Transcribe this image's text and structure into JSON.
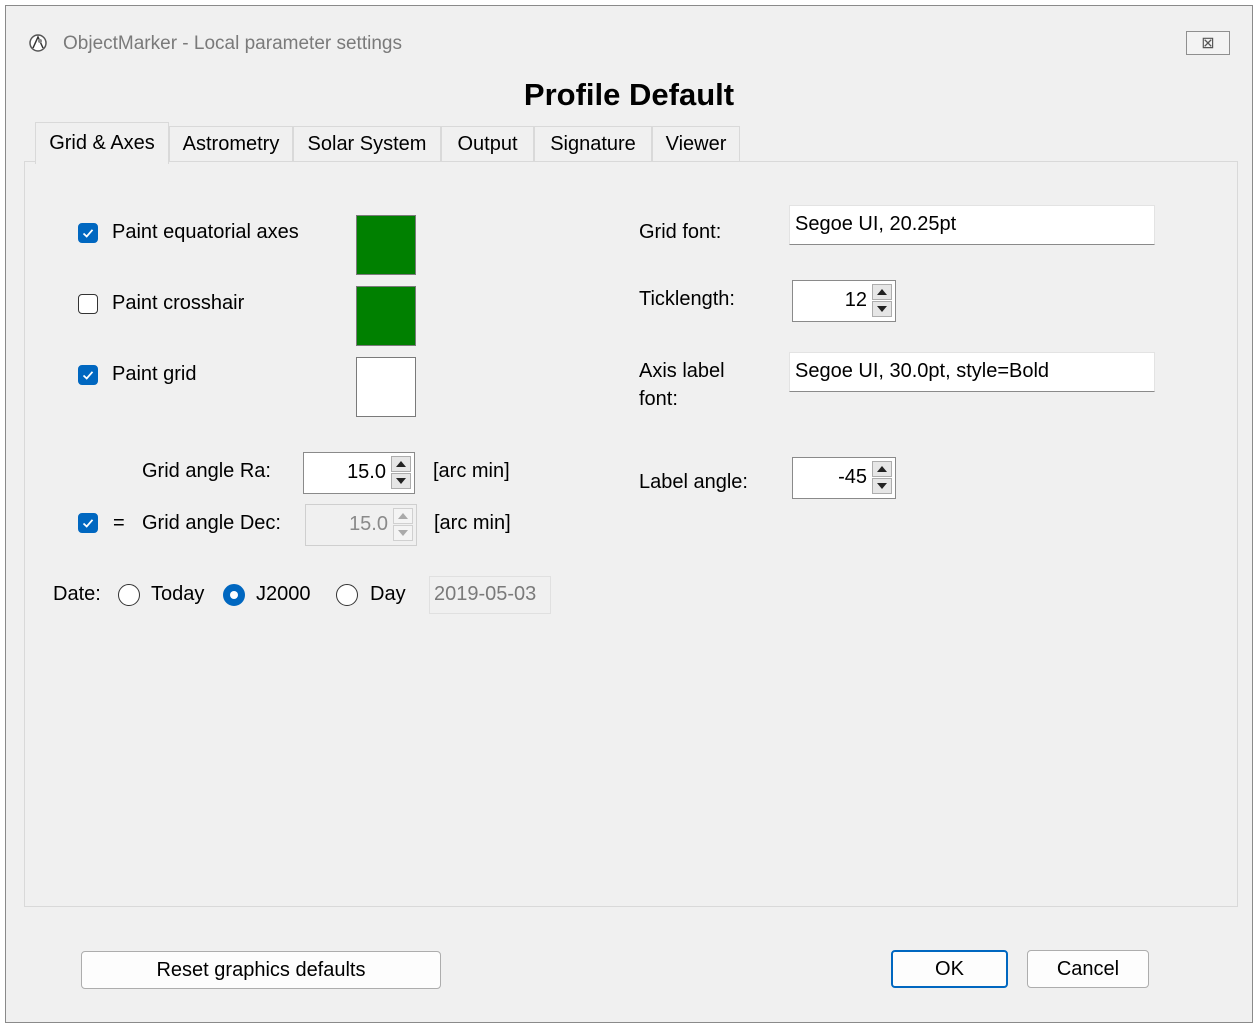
{
  "window": {
    "title": "ObjectMarker - Local parameter settings",
    "close_glyph": "⊠",
    "app_icon": "objectmarker-app-icon"
  },
  "profile_title": "Profile Default",
  "tabs": [
    {
      "label": "Grid & Axes",
      "active": true
    },
    {
      "label": "Astrometry",
      "active": false
    },
    {
      "label": "Solar System",
      "active": false
    },
    {
      "label": "Output",
      "active": false
    },
    {
      "label": "Signature",
      "active": false
    },
    {
      "label": "Viewer",
      "active": false
    }
  ],
  "left": {
    "paint_equatorial_axes": {
      "label": "Paint equatorial axes",
      "checked": true,
      "color": "#008000"
    },
    "paint_crosshair": {
      "label": "Paint crosshair",
      "checked": false,
      "color": "#008000"
    },
    "paint_grid": {
      "label": "Paint grid",
      "checked": true,
      "color": "#ffffff"
    },
    "grid_angle_ra": {
      "label": "Grid angle Ra:",
      "value": "15.0",
      "unit": "[arc min]"
    },
    "grid_angle_dec": {
      "label": "Grid angle Dec:",
      "value": "15.0",
      "unit": "[arc min]",
      "equal_checked": true,
      "equal_sign": "=",
      "disabled": true
    },
    "date": {
      "label": "Date:",
      "options": [
        {
          "label": "Today",
          "selected": false
        },
        {
          "label": "J2000",
          "selected": true
        },
        {
          "label": "Day",
          "selected": false
        }
      ],
      "day_value": "2019-05-03"
    }
  },
  "right": {
    "grid_font": {
      "label": "Grid font:",
      "value": "Segoe UI, 20.25pt"
    },
    "ticklength": {
      "label": "Ticklength:",
      "value": "12"
    },
    "axis_label_font": {
      "label_line1": "Axis label",
      "label_line2": "font:",
      "value": "Segoe UI, 30.0pt, style=Bold"
    },
    "label_angle": {
      "label": "Label angle:",
      "value": "-45"
    }
  },
  "buttons": {
    "reset": "Reset graphics defaults",
    "ok": "OK",
    "cancel": "Cancel"
  },
  "colors": {
    "accent": "#0067c0",
    "green_swatch": "#008000"
  }
}
